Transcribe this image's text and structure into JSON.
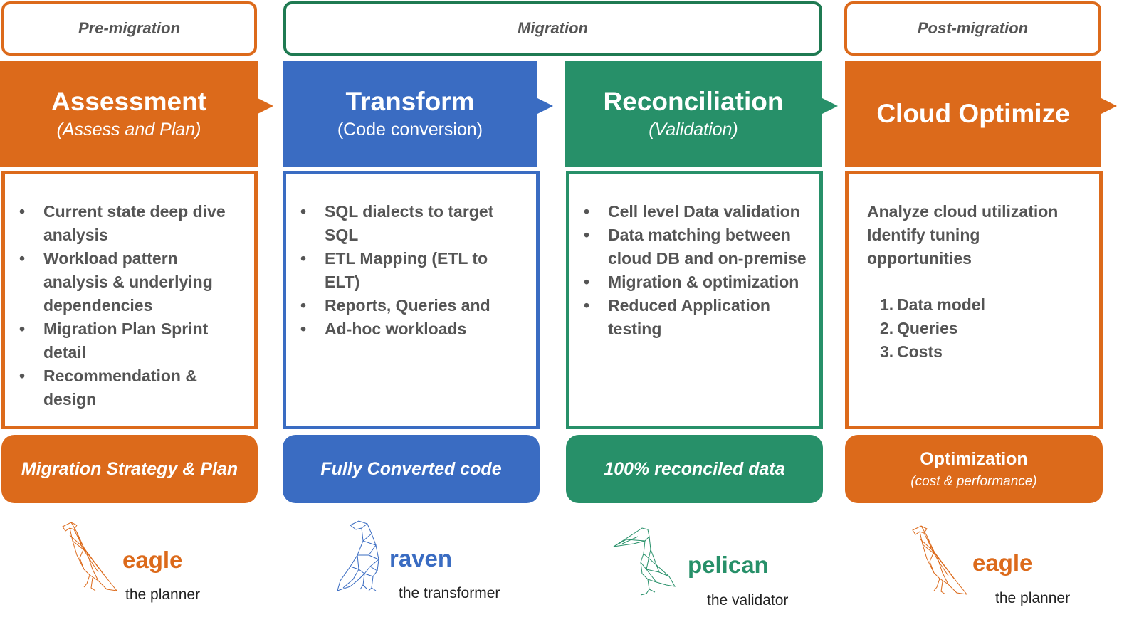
{
  "colors": {
    "orange": "#dc6a1b",
    "blue": "#3a6cc2",
    "green": "#279069",
    "dark_green": "#1f7a52",
    "text_gray": "#555555"
  },
  "phases": [
    {
      "label": "Pre-migration",
      "color": "orange"
    },
    {
      "label": "Migration",
      "color": "green"
    },
    {
      "label": "Post-migration",
      "color": "orange"
    }
  ],
  "stages": [
    {
      "title": "Assessment",
      "subtitle": "(Assess and Plan)",
      "color": "orange",
      "bullets": [
        "Current state deep dive analysis",
        "Workload pattern analysis & underlying dependencies",
        "Migration Plan Sprint detail",
        "Recommendation & design"
      ],
      "outcome": "Migration Strategy & Plan",
      "mascot": {
        "name": "eagle",
        "role": "the planner",
        "icon": "eagle-icon"
      }
    },
    {
      "title": "Transform",
      "subtitle": "(Code conversion)",
      "color": "blue",
      "bullets": [
        "SQL dialects to target SQL",
        "ETL Mapping (ETL to ELT)",
        "Reports, Queries and",
        "Ad-hoc workloads"
      ],
      "outcome": "Fully Converted code",
      "mascot": {
        "name": "raven",
        "role": "the transformer",
        "icon": "raven-icon"
      }
    },
    {
      "title": "Reconciliation",
      "subtitle": "(Validation)",
      "color": "green",
      "bullets": [
        "Cell level Data validation",
        "Data matching between cloud DB and on-premise",
        "Migration & optimization",
        "Reduced Application testing"
      ],
      "outcome": "100% reconciled data",
      "mascot": {
        "name": "pelican",
        "role": "the validator",
        "icon": "pelican-icon"
      }
    },
    {
      "title": "Cloud Optimize",
      "subtitle": "",
      "color": "orange",
      "lines": [
        "Analyze cloud utilization",
        "Identify tuning opportunities"
      ],
      "numbered": [
        {
          "n": "1.",
          "text": "Data model"
        },
        {
          "n": "2.",
          "text": "Queries"
        },
        {
          "n": "3.",
          "text": "Costs"
        }
      ],
      "outcome": "Optimization",
      "outcome_sub": "(cost & performance)",
      "mascot": {
        "name": "eagle",
        "role": "the planner",
        "icon": "eagle-icon"
      }
    }
  ]
}
